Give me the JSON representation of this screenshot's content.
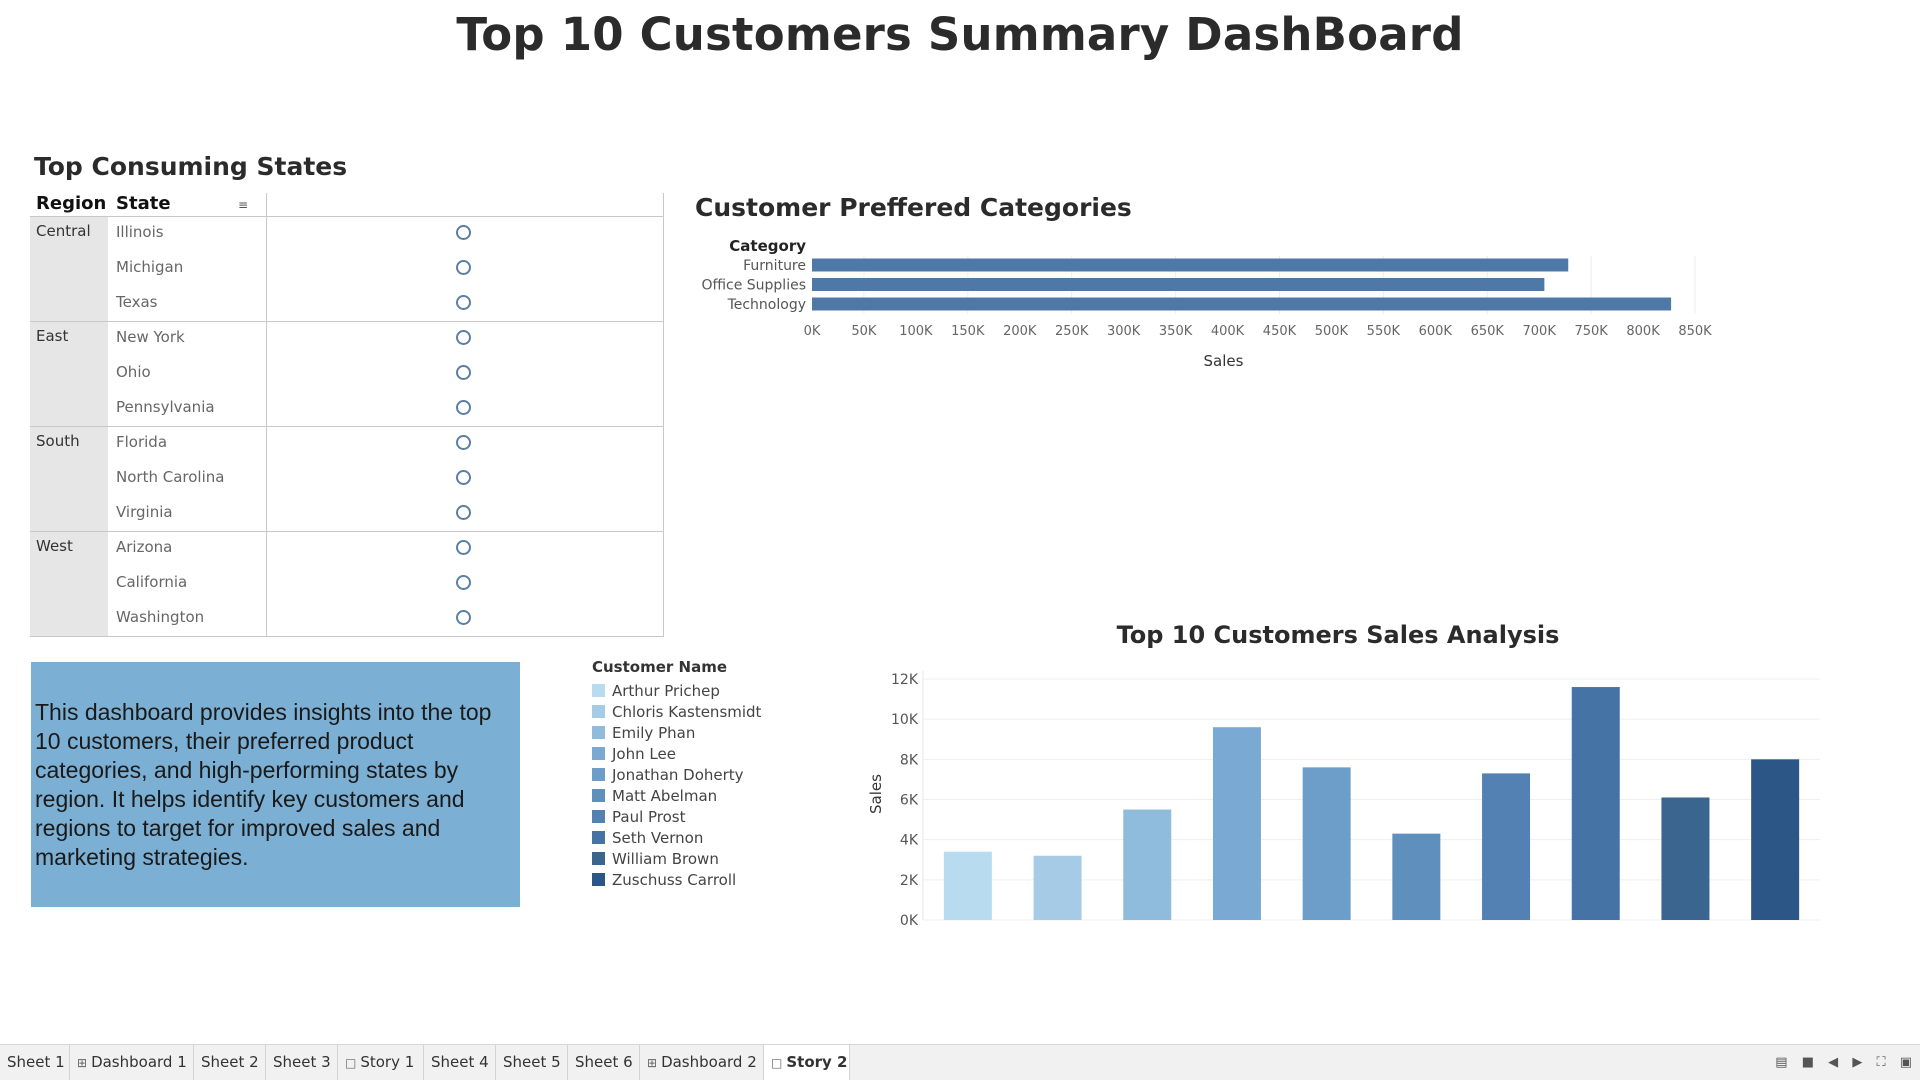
{
  "dashboard_title": "Top 10 Customers Summary DashBoard",
  "states_panel": {
    "title": "Top Consuming States",
    "columns": [
      "Region",
      "State"
    ],
    "regions": [
      {
        "name": "Central",
        "states": [
          "Illinois",
          "Michigan",
          "Texas"
        ]
      },
      {
        "name": "East",
        "states": [
          "New York",
          "Ohio",
          "Pennsylvania"
        ]
      },
      {
        "name": "South",
        "states": [
          "Florida",
          "North Carolina",
          "Virginia"
        ]
      },
      {
        "name": "West",
        "states": [
          "Arizona",
          "California",
          "Washington"
        ]
      }
    ],
    "mark_color": "#5b7ea6"
  },
  "description": "This dashboard provides insights into the top 10 customers, their preferred product categories, and high-performing states by region. It helps identify key customers and regions to target for improved sales and marketing strategies.",
  "legend": {
    "title": "Customer Name",
    "items": [
      {
        "name": "Arthur Prichep",
        "color": "#b9dbef"
      },
      {
        "name": "Chloris Kastensmidt",
        "color": "#a5cbe6"
      },
      {
        "name": "Emily Phan",
        "color": "#8fbbdc"
      },
      {
        "name": "John Lee",
        "color": "#7aaad3"
      },
      {
        "name": "Jonathan Doherty",
        "color": "#6d9ec9"
      },
      {
        "name": "Matt Abelman",
        "color": "#5f8fbd"
      },
      {
        "name": "Paul Prost",
        "color": "#5381b3"
      },
      {
        "name": "Seth Vernon",
        "color": "#4673a5"
      },
      {
        "name": "William Brown",
        "color": "#39658f"
      },
      {
        "name": "Zuschuss Carroll",
        "color": "#2c5685"
      }
    ]
  },
  "chart_data": [
    {
      "type": "bar",
      "orientation": "horizontal",
      "title": "Customer Preffered Categories",
      "category_header": "Category",
      "categories": [
        "Furniture",
        "Office Supplies",
        "Technology"
      ],
      "values": [
        728000,
        705000,
        827000
      ],
      "xlabel": "Sales",
      "xlim": [
        0,
        850000
      ],
      "ticks": [
        "0K",
        "50K",
        "100K",
        "150K",
        "200K",
        "250K",
        "300K",
        "350K",
        "400K",
        "450K",
        "500K",
        "550K",
        "600K",
        "650K",
        "700K",
        "750K",
        "800K",
        "850K"
      ],
      "color": "#4e79a7",
      "grid": true
    },
    {
      "type": "bar",
      "title": "Top 10 Customers Sales Analysis",
      "ylabel": "Sales",
      "categories": [
        "Arthur Prichep",
        "Chloris Kastensmidt",
        "Emily Phan",
        "John Lee",
        "Jonathan Doherty",
        "Matt Abelman",
        "Paul Prost",
        "Seth Vernon",
        "William Brown",
        "Zuschuss Carroll"
      ],
      "values": [
        3400,
        3200,
        5500,
        9600,
        7600,
        4300,
        7300,
        11600,
        6100,
        8000
      ],
      "ylim": [
        0,
        12000
      ],
      "ticks": [
        "0K",
        "2K",
        "4K",
        "6K",
        "8K",
        "10K",
        "12K"
      ],
      "grid": true
    }
  ],
  "tabs": [
    {
      "label": "Sheet 1",
      "icon": ""
    },
    {
      "label": "Dashboard 1",
      "icon": "dashboard-icon"
    },
    {
      "label": "Sheet 2",
      "icon": ""
    },
    {
      "label": "Sheet 3",
      "icon": ""
    },
    {
      "label": "Story 1",
      "icon": "story-icon"
    },
    {
      "label": "Sheet 4",
      "icon": ""
    },
    {
      "label": "Sheet 5",
      "icon": ""
    },
    {
      "label": "Sheet 6",
      "icon": ""
    },
    {
      "label": "Dashboard 2",
      "icon": "dashboard-icon"
    },
    {
      "label": "Story 2",
      "icon": "story-icon",
      "active": true
    }
  ]
}
